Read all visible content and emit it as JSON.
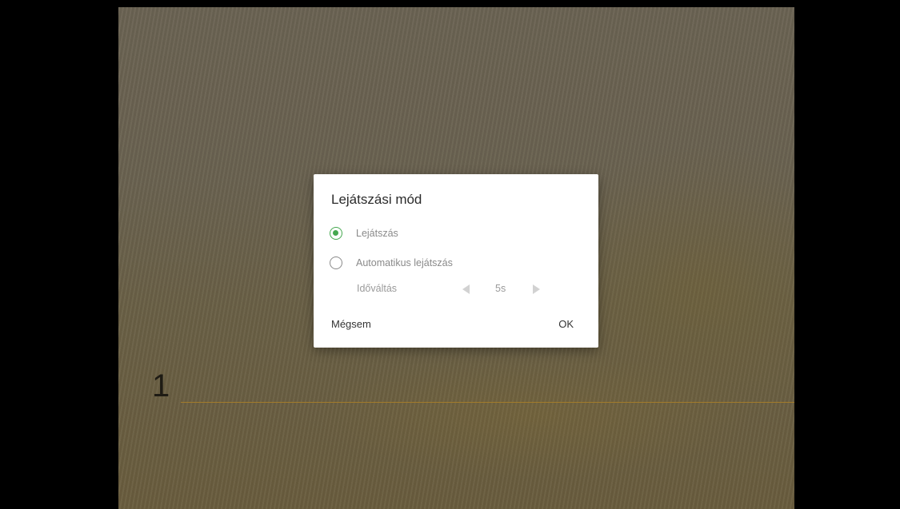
{
  "slide": {
    "number": "1"
  },
  "dialog": {
    "title": "Lejátszási mód",
    "options": [
      {
        "label": "Lejátszás",
        "checked": true
      },
      {
        "label": "Automatikus lejátszás",
        "checked": false
      }
    ],
    "interval": {
      "label": "Időváltás",
      "value": "5s"
    },
    "cancel_label": "Mégsem",
    "ok_label": "OK"
  },
  "colors": {
    "accent_green": "#45a84f",
    "slide_rule": "#a27b2b"
  }
}
